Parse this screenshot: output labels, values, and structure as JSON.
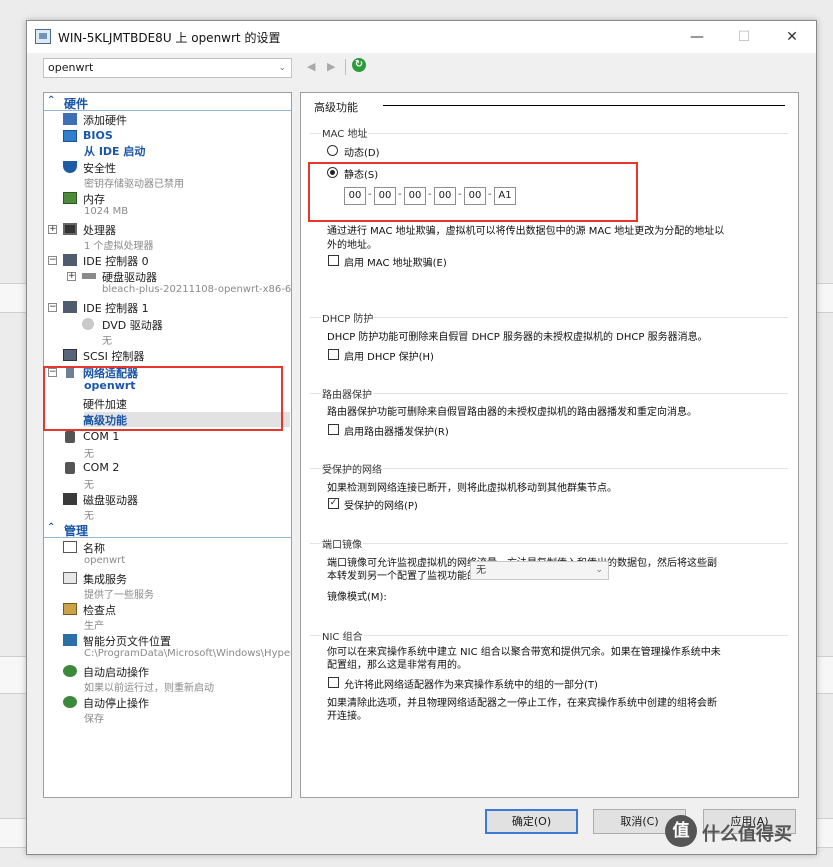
{
  "window": {
    "title": "WIN-5KLJMTBDE8U 上 openwrt 的设置",
    "minimize": "—",
    "maximize": "☐",
    "close": "✕"
  },
  "toolbar": {
    "vm_name": "openwrt",
    "back": "◀",
    "forward": "▶",
    "refresh": "↻"
  },
  "sidebar": {
    "hardware_header": "硬件",
    "management_header": "管理",
    "items": {
      "add_hardware": "添加硬件",
      "bios": "BIOS",
      "bios_sub": "从 IDE 启动",
      "security": "安全性",
      "security_sub": "密钥存储驱动器已禁用",
      "memory": "内存",
      "memory_sub": "1024 MB",
      "processor": "处理器",
      "processor_sub": "1 个虚拟处理器",
      "ide0": "IDE 控制器 0",
      "hard_drive": "硬盘驱动器",
      "hard_drive_sub": "bleach-plus-20211108-openwrt-x86-6...",
      "ide1": "IDE 控制器 1",
      "dvd": "DVD 驱动器",
      "dvd_sub": "无",
      "scsi": "SCSI 控制器",
      "network": "网络适配器",
      "network_sub": "openwrt",
      "hw_accel": "硬件加速",
      "advanced": "高级功能",
      "com1": "COM 1",
      "com1_sub": "无",
      "com2": "COM 2",
      "com2_sub": "无",
      "floppy": "磁盘驱动器",
      "floppy_sub": "无",
      "name": "名称",
      "name_sub": "openwrt",
      "integration": "集成服务",
      "integration_sub": "提供了一些服务",
      "checkpoints": "检查点",
      "checkpoints_sub": "生产",
      "paging": "智能分页文件位置",
      "paging_sub": "C:\\ProgramData\\Microsoft\\Windows\\Hyper-V",
      "auto_start": "自动启动操作",
      "auto_start_sub": "如果以前运行过，则重新启动",
      "auto_stop": "自动停止操作",
      "auto_stop_sub": "保存"
    }
  },
  "panel": {
    "title": "高级功能",
    "mac": {
      "group_title": "MAC 地址",
      "dynamic_label": "动态(D)",
      "static_label": "静态(S)",
      "segments": [
        "00",
        "00",
        "00",
        "00",
        "00",
        "A1"
      ],
      "desc": "通过进行 MAC 地址欺骗，虚拟机可以将传出数据包中的源 MAC 地址更改为分配的地址以外的地址。",
      "desc_line1": "通过进行 MAC 地址欺骗，虚拟机可以将传出数据包中的源 MAC 地址更改为分配的地址以",
      "desc_line2": "外的地址。",
      "spoof_label": "启用 MAC 地址欺骗(E)"
    },
    "dhcp": {
      "group_title": "DHCP 防护",
      "desc": "DHCP 防护功能可删除来自假冒 DHCP 服务器的未授权虚拟机的 DHCP 服务器消息。",
      "checkbox": "启用 DHCP 保护(H)"
    },
    "router": {
      "group_title": "路由器保护",
      "desc": "路由器保护功能可删除来自假冒路由器的未授权虚拟机的路由器播发和重定向消息。",
      "checkbox": "启用路由器播发保护(R)"
    },
    "protected": {
      "group_title": "受保护的网络",
      "desc": "如果检测到网络连接已断开，则将此虚拟机移动到其他群集节点。",
      "checkbox": "受保护的网络(P)",
      "check_mark": "✓"
    },
    "mirror": {
      "group_title": "端口镜像",
      "desc_line1": "端口镜像可允许监视虚拟机的网络流量，方法是复制传入和传出的数据包，然后将这些副",
      "desc_line2": "本转发到另一个配置了监视功能的虚拟机。",
      "mode_label": "镜像模式(M):",
      "mode_value": "无"
    },
    "nic": {
      "group_title": "NIC 组合",
      "desc_line1": "你可以在来宾操作系统中建立 NIC 组合以聚合带宽和提供冗余。如果在管理操作系统中未",
      "desc_line2": "配置组，那么这是非常有用的。",
      "checkbox": "允许将此网络适配器作为来宾操作系统中的组的一部分(T)",
      "note_line1": "如果清除此选项，并且物理网络适配器之一停止工作，在来宾操作系统中创建的组将会断",
      "note_line2": "开连接。"
    }
  },
  "buttons": {
    "ok": "确定(O)",
    "cancel": "取消(C)",
    "apply": "应用(A)"
  },
  "watermark": {
    "logo": "值",
    "text": "什么值得买"
  }
}
